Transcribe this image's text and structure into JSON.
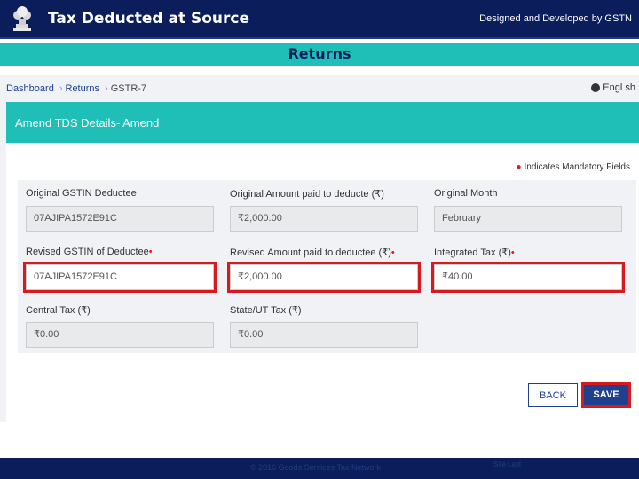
{
  "header": {
    "title": "Tax Deducted at Source",
    "designed_by": "Designed and Developed by GSTN"
  },
  "section": {
    "title": "Returns"
  },
  "breadcrumb": {
    "items": [
      "Dashboard",
      "Returns",
      "GSTR-7"
    ],
    "separator": "›"
  },
  "language": {
    "label": "Engl sh"
  },
  "card": {
    "title": "Amend TDS Details- Amend",
    "mandatory_note": "Indicates Mandatory Fields"
  },
  "fields": {
    "orig_gstin": {
      "label": "Original GSTIN Deductee",
      "value": "07AJIPA1572E91C"
    },
    "orig_amount": {
      "label": "Original Amount paid to deducte (₹)",
      "value": "₹2,000.00"
    },
    "orig_month": {
      "label": "Original Month",
      "value": "February"
    },
    "rev_gstin": {
      "label": "Revised GSTIN of Deductee",
      "value": "07AJIPA1572E91C"
    },
    "rev_amount": {
      "label": "Revised Amount paid to deductee (₹)",
      "value": "₹2,000.00"
    },
    "igst": {
      "label": "Integrated Tax (₹)",
      "value": "₹40.00"
    },
    "cgst": {
      "label": "Central Tax (₹)",
      "value": "₹0.00"
    },
    "sgst": {
      "label": "State/UT Tax (₹)",
      "value": "₹0.00"
    }
  },
  "buttons": {
    "back": "BACK",
    "save": "SAVE"
  },
  "footer": {
    "left": "© 2016 Goods Services Tax Network",
    "right": "Site Last"
  },
  "colors": {
    "header_bg": "#0b1e5b",
    "teal": "#1fbfb8",
    "highlight": "#d71920",
    "primary": "#1f3f8f"
  },
  "icons": {
    "emblem": "state-emblem-icon",
    "globe": "globe-icon",
    "star": "required-star-icon"
  }
}
